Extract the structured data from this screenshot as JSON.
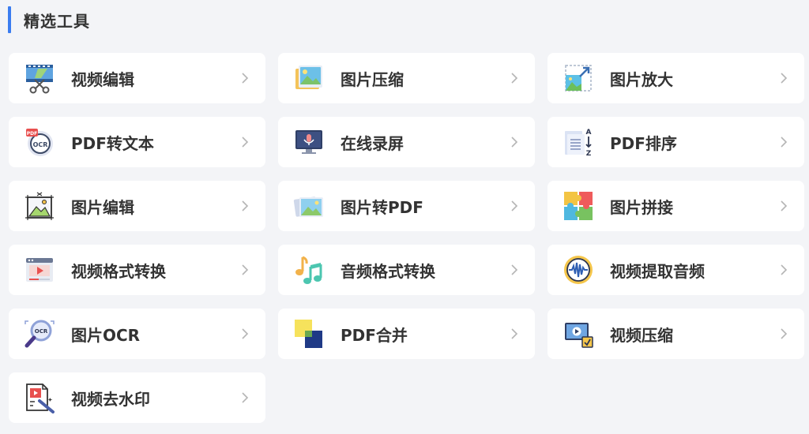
{
  "section": {
    "title": "精选工具",
    "accent_color": "#3a7cf0"
  },
  "tools": [
    {
      "label": "视频编辑",
      "icon": "video-edit-icon"
    },
    {
      "label": "图片压缩",
      "icon": "image-compress-icon"
    },
    {
      "label": "图片放大",
      "icon": "image-enlarge-icon"
    },
    {
      "label": "PDF转文本",
      "icon": "pdf-ocr-icon"
    },
    {
      "label": "在线录屏",
      "icon": "screen-record-icon"
    },
    {
      "label": "PDF排序",
      "icon": "pdf-sort-icon"
    },
    {
      "label": "图片编辑",
      "icon": "image-edit-icon"
    },
    {
      "label": "图片转PDF",
      "icon": "image-to-pdf-icon"
    },
    {
      "label": "图片拼接",
      "icon": "puzzle-icon"
    },
    {
      "label": "视频格式转换",
      "icon": "video-convert-icon"
    },
    {
      "label": "音频格式转换",
      "icon": "music-note-icon"
    },
    {
      "label": "视频提取音频",
      "icon": "audio-wave-icon"
    },
    {
      "label": "图片OCR",
      "icon": "ocr-magnifier-icon"
    },
    {
      "label": "PDF合并",
      "icon": "pdf-merge-icon"
    },
    {
      "label": "视频压缩",
      "icon": "video-compress-icon"
    },
    {
      "label": "视频去水印",
      "icon": "watermark-remove-icon"
    }
  ]
}
